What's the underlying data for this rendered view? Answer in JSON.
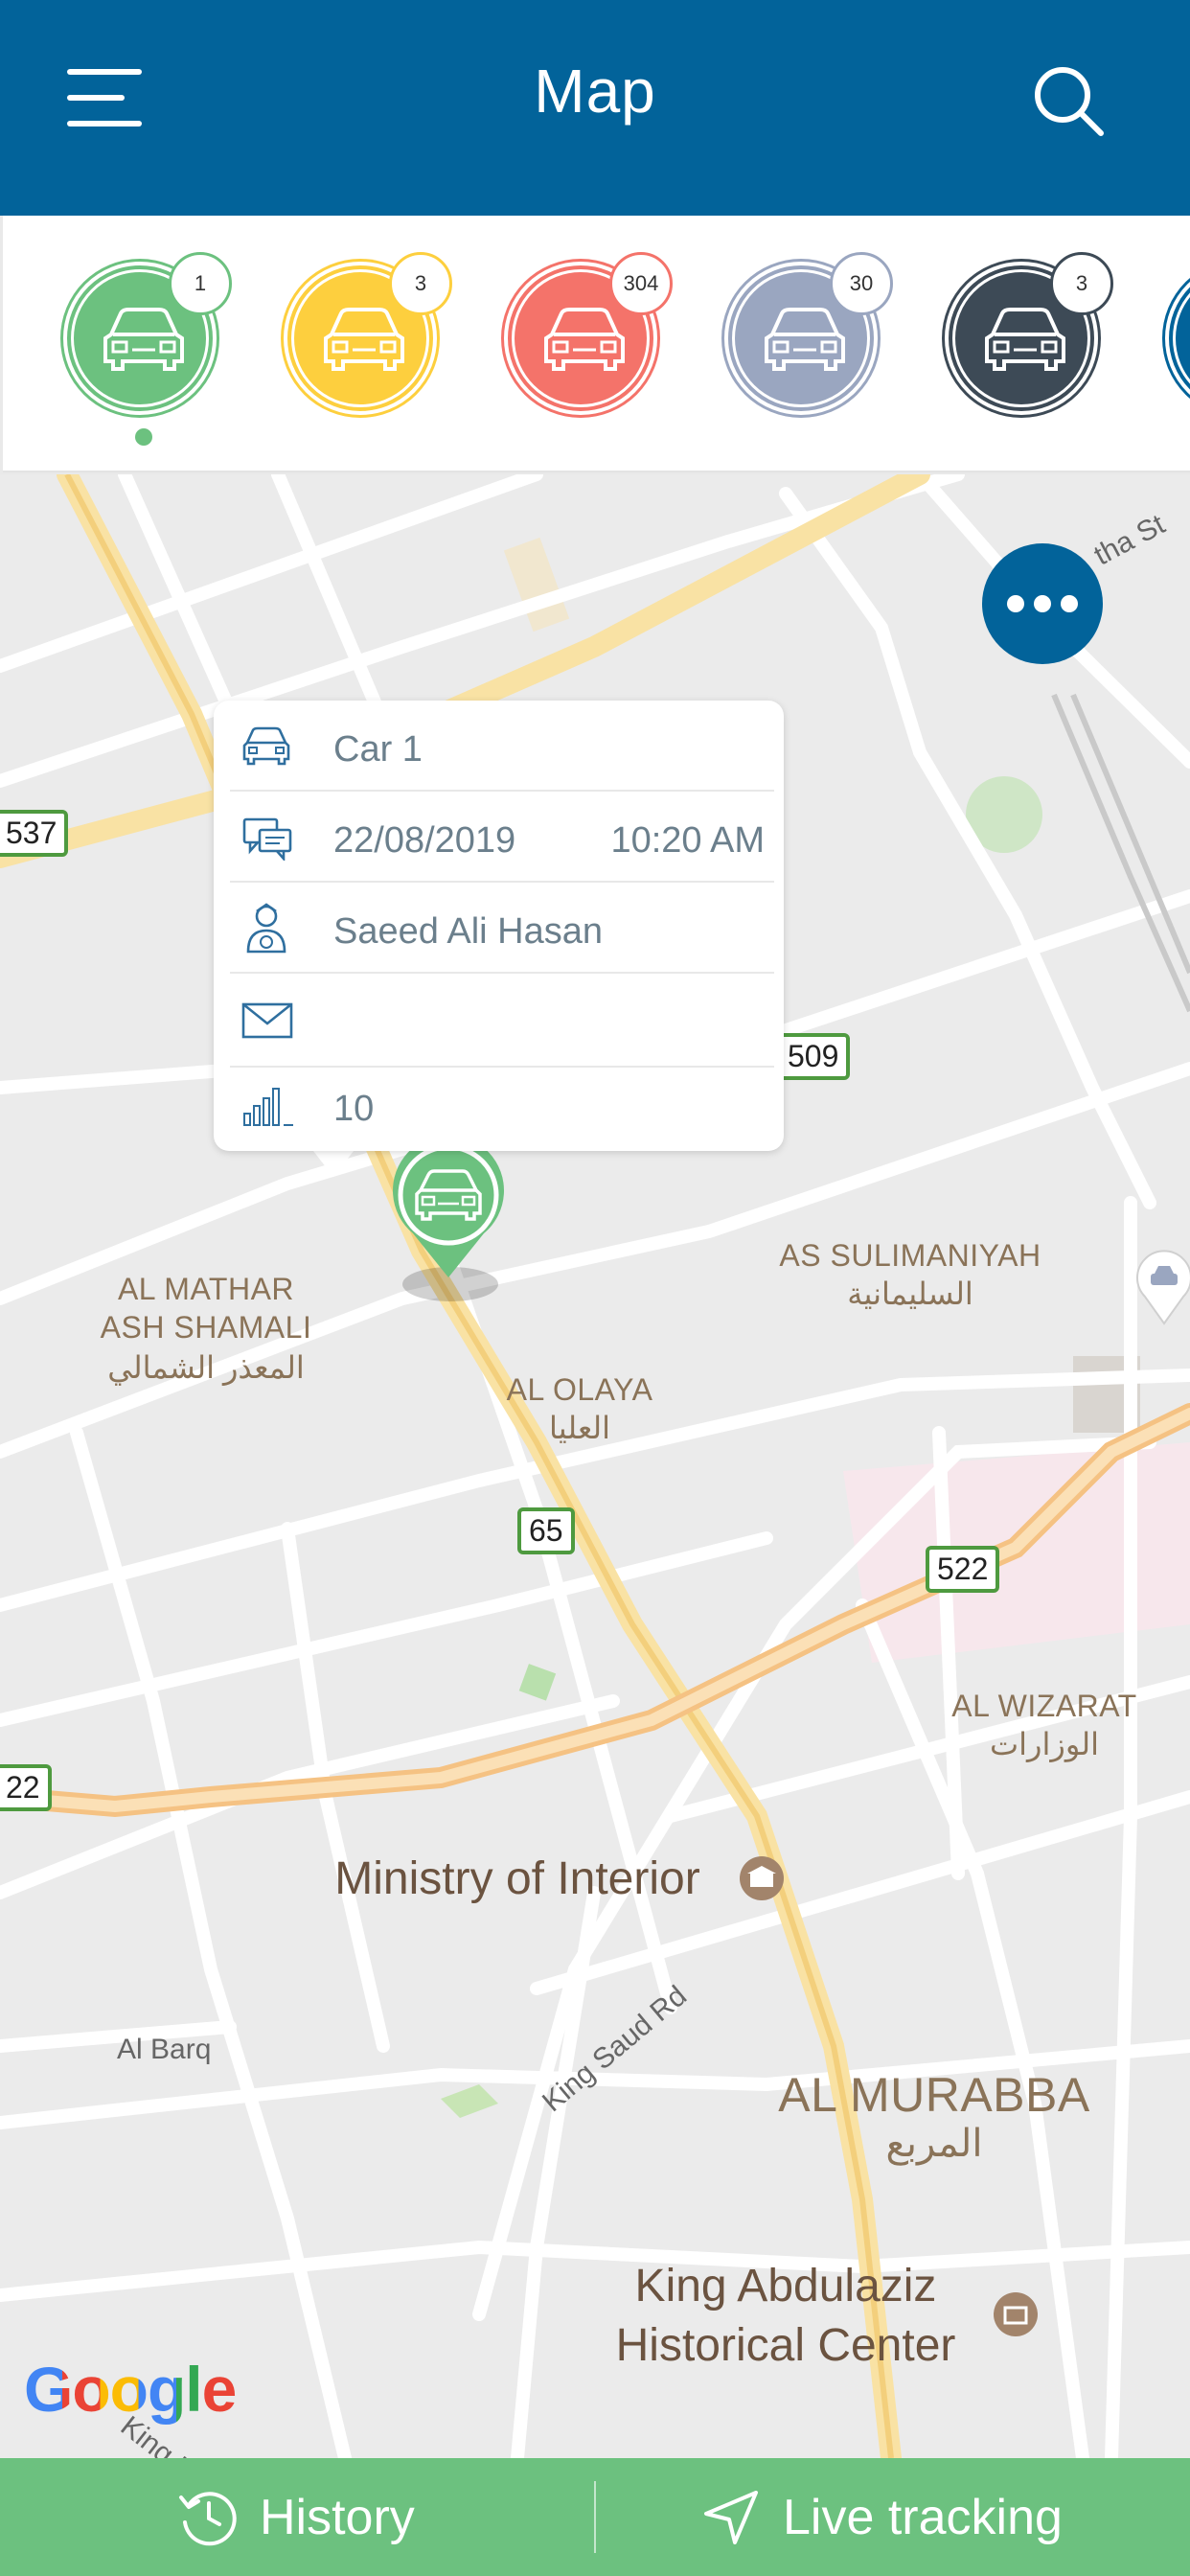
{
  "header": {
    "title": "Map"
  },
  "statuses": [
    {
      "count": "1",
      "color": "#6cc17f"
    },
    {
      "count": "3",
      "color": "#fdcf3e"
    },
    {
      "count": "304",
      "color": "#f4736a"
    },
    {
      "count": "30",
      "color": "#9aa6c0"
    },
    {
      "count": "3",
      "color": "#3d4a56"
    }
  ],
  "popup": {
    "car_name": "Car 1",
    "date": "22/08/2019",
    "time": "10:20 AM",
    "driver": "Saeed Ali Hasan",
    "email": "",
    "signal": "10"
  },
  "map": {
    "areas": [
      {
        "en": "AL MATHAR\nASH SHAMALI",
        "ar": "المعذر الشمالي"
      },
      {
        "en": "AL OLAYA",
        "ar": "العليا"
      },
      {
        "en": "AS SULIMANIYAH",
        "ar": "السليمانية"
      },
      {
        "en": "AL WIZARAT",
        "ar": "الوزارات"
      },
      {
        "en": "AL MURABBA",
        "ar": "المربع"
      }
    ],
    "pois": [
      "Ministry of Interior",
      "King Abdulaziz\nHistorical Center"
    ],
    "roads": [
      "King Khalid Rd",
      "King Saud Rd",
      "Al Barq",
      "tha St"
    ],
    "shields": [
      "537",
      "509",
      "65",
      "522",
      "22"
    ],
    "attribution": "Google"
  },
  "bottom": {
    "history": "History",
    "live": "Live tracking"
  },
  "colors": {
    "brand": "#02639a",
    "accent": "#6cc17f"
  }
}
